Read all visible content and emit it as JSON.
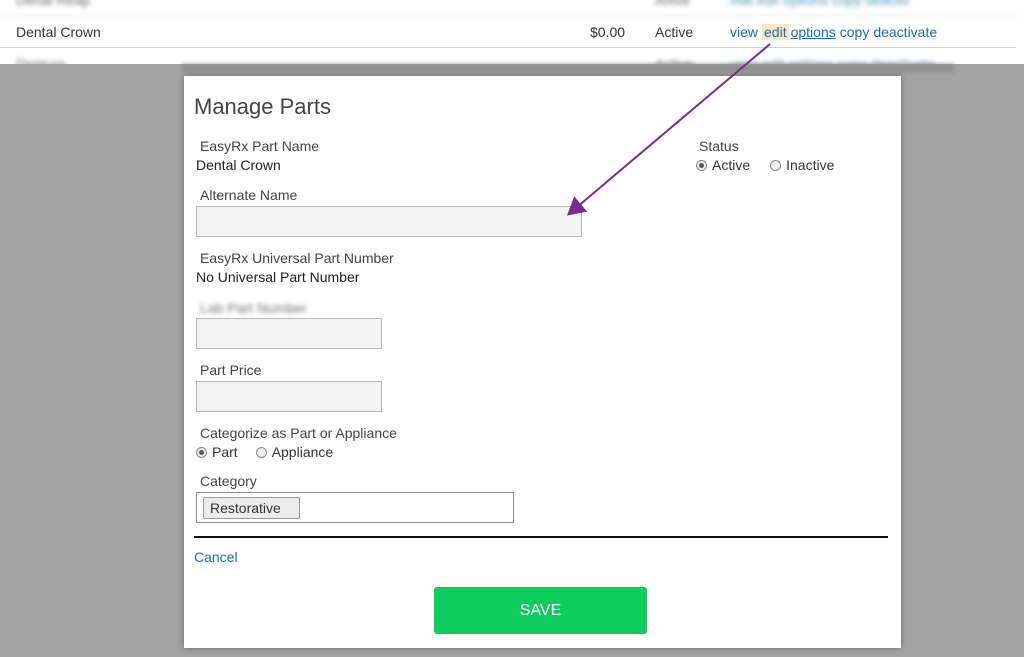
{
  "background_table": {
    "top_row": {
      "name": "Denal Reap",
      "status": "Arlive",
      "actions": "mai edit options copy deactiv"
    },
    "main_row": {
      "name": "Dental Crown",
      "price": "$0.00",
      "status": "Active",
      "actions": {
        "view": "view",
        "edit": "edit",
        "options": "options",
        "copy": "copy",
        "deactivate": "deactivate"
      }
    },
    "bottom_row": {
      "name": "Denture",
      "status": "Active",
      "actions": "view edit options copy deactivate"
    }
  },
  "modal": {
    "title": "Manage Parts",
    "part_name_label": "EasyRx Part Name",
    "part_name_value": "Dental Crown",
    "status_label": "Status",
    "status_options": [
      {
        "label": "Active",
        "checked": true
      },
      {
        "label": "Inactive",
        "checked": false
      }
    ],
    "alternate_name_label": "Alternate Name",
    "alternate_name_value": "",
    "universal_label": "EasyRx Universal Part Number",
    "universal_value": "No Universal Part Number",
    "lab_part_label": "Lab Part Number",
    "lab_part_value": "",
    "part_price_label": "Part Price",
    "part_price_value": "",
    "categorize_label": "Categorize as Part or Appliance",
    "categorize_options": [
      {
        "label": "Part",
        "checked": true
      },
      {
        "label": "Appliance",
        "checked": false
      }
    ],
    "category_label": "Category",
    "category_selected": "Restorative",
    "cancel_label": "Cancel",
    "save_label": "SAVE"
  },
  "colors": {
    "link": "#1a6fa8",
    "save_button": "#0fcc5f",
    "overlay": "#a3a3a3",
    "arrow": "#7b2d8e",
    "edit_highlight": "#fbe7c6"
  }
}
